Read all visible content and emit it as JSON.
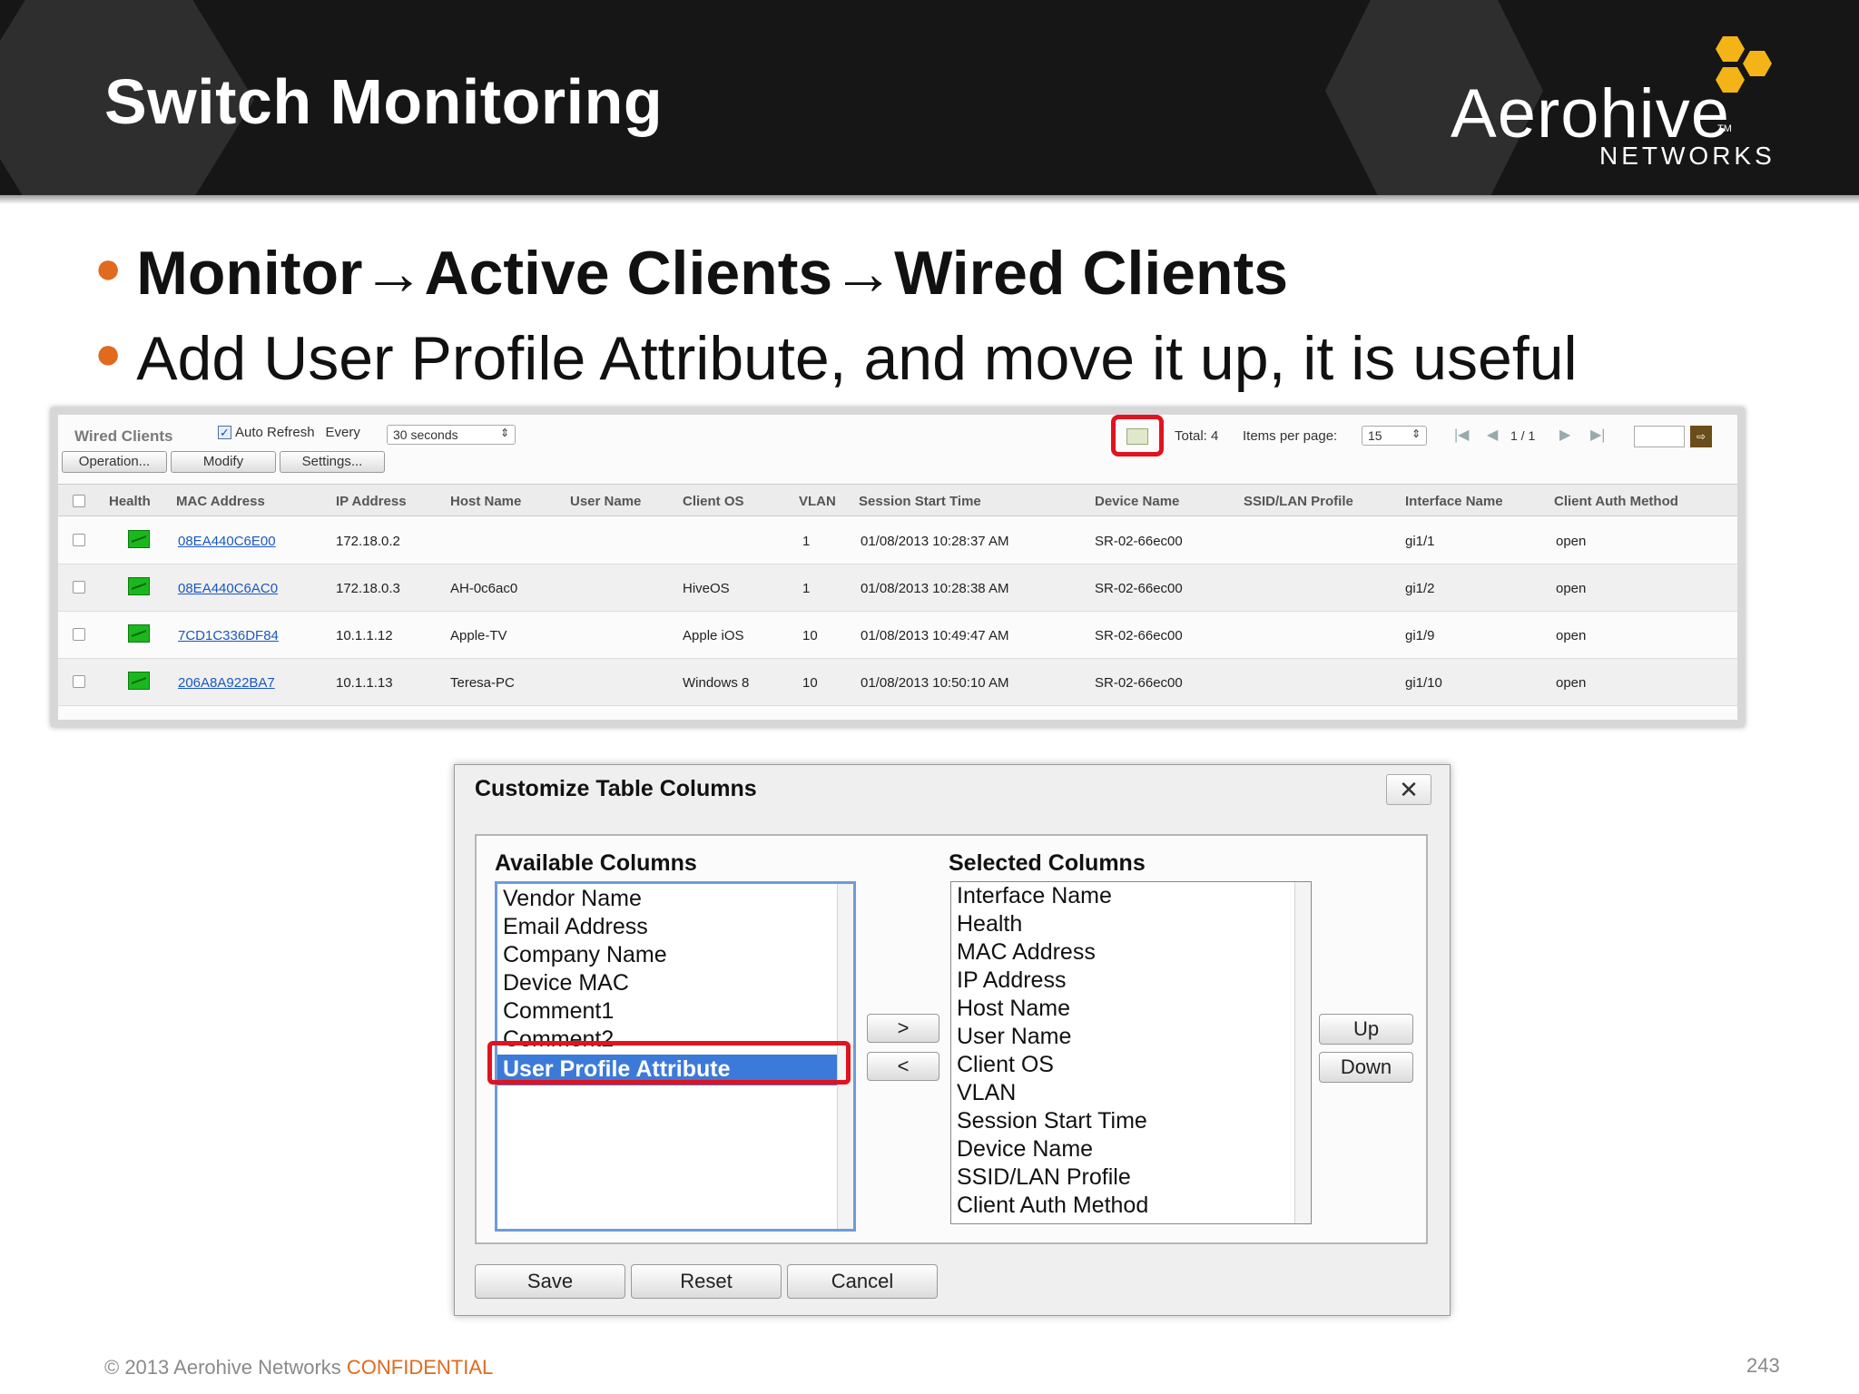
{
  "slide": {
    "title": "Switch Monitoring",
    "logo": {
      "word": "Aerohive",
      "tm": "TM",
      "sub": "NETWORKS"
    },
    "bullets": [
      "Monitor→Active Clients→Wired Clients",
      "Add User Profile Attribute, and move it up, it is useful"
    ],
    "footer": {
      "copyright": "© 2013 Aerohive Networks ",
      "confidential": "CONFIDENTIAL",
      "page": "243"
    }
  },
  "wired_clients": {
    "title": "Wired Clients",
    "auto_refresh_label": "Auto Refresh",
    "auto_refresh_checked": true,
    "every_label": "Every",
    "interval": "30 seconds",
    "total": "Total: 4",
    "items_per_page_label": "Items per page:",
    "items_per_page": "15",
    "page_indicator": "1 / 1",
    "buttons": {
      "operation": "Operation...",
      "modify": "Modify",
      "settings": "Settings..."
    },
    "columns": [
      "Health",
      "MAC Address",
      "IP Address",
      "Host Name",
      "User Name",
      "Client OS",
      "VLAN",
      "Session Start Time",
      "Device Name",
      "SSID/LAN Profile",
      "Interface Name",
      "Client Auth Method"
    ],
    "rows": [
      {
        "mac": "08EA440C6E00",
        "ip": "172.18.0.2",
        "host": "",
        "user": "",
        "os": "",
        "vlan": "1",
        "start": "01/08/2013 10:28:37 AM",
        "device": "SR-02-66ec00",
        "ssid": "",
        "iface": "gi1/1",
        "auth": "open"
      },
      {
        "mac": "08EA440C6AC0",
        "ip": "172.18.0.3",
        "host": "AH-0c6ac0",
        "user": "",
        "os": "HiveOS",
        "vlan": "1",
        "start": "01/08/2013 10:28:38 AM",
        "device": "SR-02-66ec00",
        "ssid": "",
        "iface": "gi1/2",
        "auth": "open"
      },
      {
        "mac": "7CD1C336DF84",
        "ip": "10.1.1.12",
        "host": "Apple-TV",
        "user": "",
        "os": "Apple iOS",
        "vlan": "10",
        "start": "01/08/2013 10:49:47 AM",
        "device": "SR-02-66ec00",
        "ssid": "",
        "iface": "gi1/9",
        "auth": "open"
      },
      {
        "mac": "206A8A922BA7",
        "ip": "10.1.1.13",
        "host": "Teresa-PC",
        "user": "",
        "os": "Windows 8",
        "vlan": "10",
        "start": "01/08/2013 10:50:10 AM",
        "device": "SR-02-66ec00",
        "ssid": "",
        "iface": "gi1/10",
        "auth": "open"
      }
    ]
  },
  "dialog": {
    "title": "Customize Table Columns",
    "close_symbol": "✕",
    "available_label": "Available Columns",
    "selected_label": "Selected Columns",
    "available": [
      "Vendor Name",
      "Email Address",
      "Company Name",
      "Device MAC",
      "Comment1",
      "Comment2",
      "User Profile Attribute"
    ],
    "available_selected": "User Profile Attribute",
    "selected": [
      "Interface Name",
      "Health",
      "MAC Address",
      "IP Address",
      "Host Name",
      "User Name",
      "Client OS",
      "VLAN",
      "Session Start Time",
      "Device Name",
      "SSID/LAN Profile",
      "Client Auth Method"
    ],
    "move_right": ">",
    "move_left": "<",
    "up": "Up",
    "down": "Down",
    "save": "Save",
    "reset": "Reset",
    "cancel": "Cancel"
  },
  "colors": {
    "accent": "#e06a1e",
    "highlight": "#e0131e",
    "selection": "#3b7ad9",
    "logo_hex": "#f4b418"
  }
}
